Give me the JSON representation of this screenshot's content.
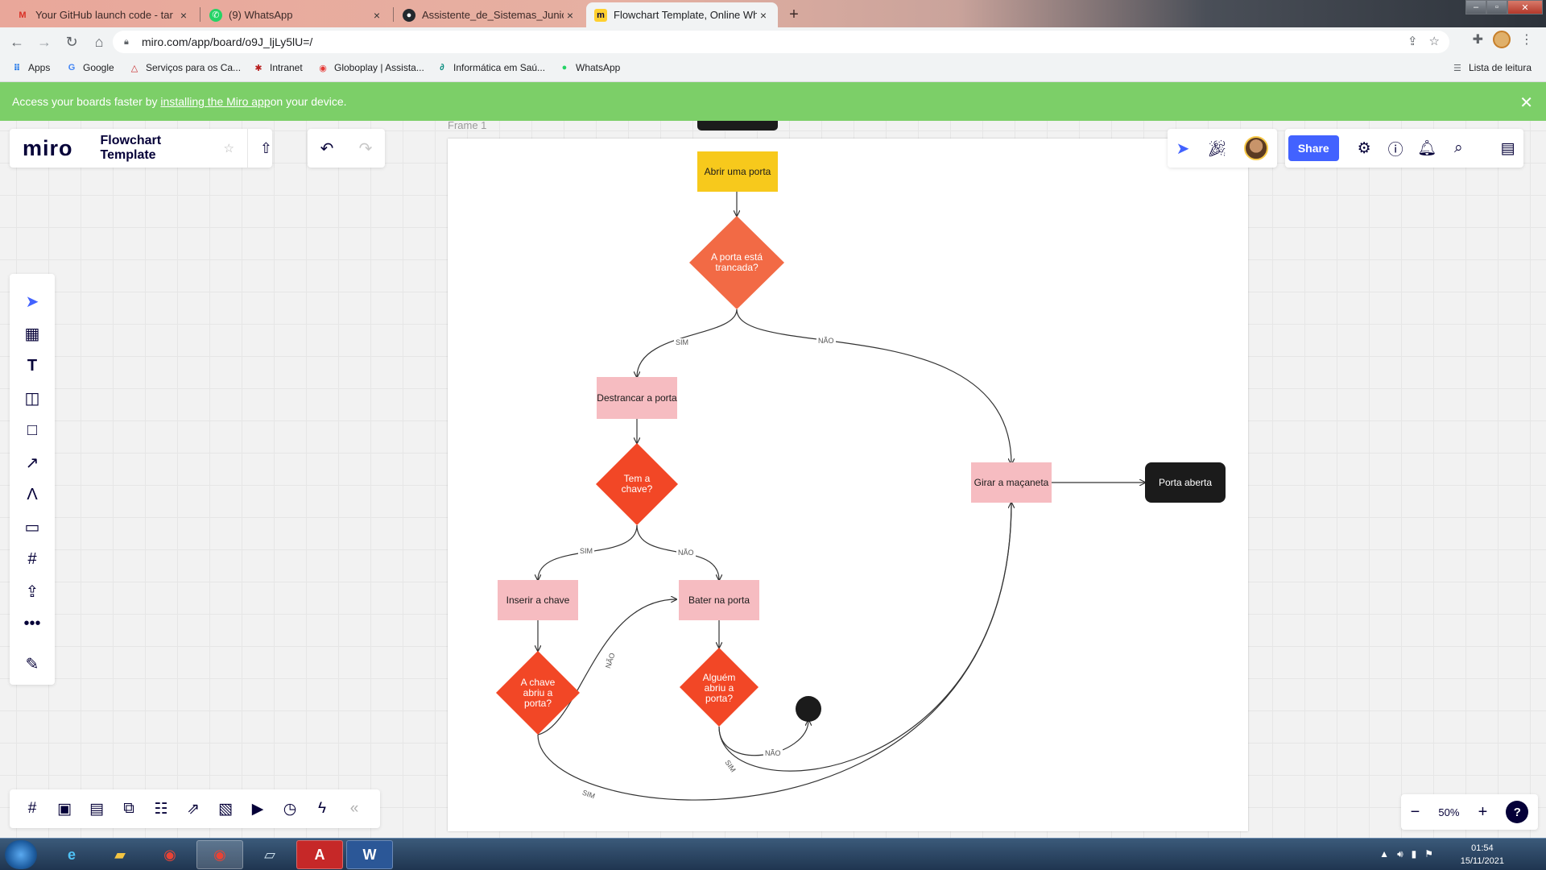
{
  "browser": {
    "tabs": [
      {
        "title": "Your GitHub launch code - tar",
        "icon": "gmail-icon"
      },
      {
        "title": "(9) WhatsApp",
        "icon": "whatsapp-icon"
      },
      {
        "title": "Assistente_de_Sistemas_Junior-T",
        "icon": "github-icon"
      },
      {
        "title": "Flowchart Template, Online Whit",
        "icon": "miro-icon",
        "active": true
      }
    ],
    "url": "miro.com/app/board/o9J_ljLy5lU=/",
    "bookmarks": [
      {
        "label": "Apps",
        "icon": "apps-grid-icon"
      },
      {
        "label": "Google",
        "icon": "google-icon"
      },
      {
        "label": "Serviços para os Ca...",
        "icon": "gov-icon"
      },
      {
        "label": "Intranet",
        "icon": "intranet-icon"
      },
      {
        "label": "Globoplay | Assista...",
        "icon": "globoplay-icon"
      },
      {
        "label": "Informática em Saú...",
        "icon": "link-icon"
      },
      {
        "label": "WhatsApp",
        "icon": "whatsapp-icon"
      }
    ],
    "reading_list": "Lista de leitura"
  },
  "banner": {
    "text_before": "Access your boards faster by ",
    "link": "installing the Miro app",
    "text_after": " on your device."
  },
  "miro": {
    "logo": "miro",
    "board_name": "Flowchart Template",
    "share_label": "Share",
    "frame_label": "Frame 1",
    "zoom": "50%",
    "help": "?"
  },
  "flowchart": {
    "nodes": {
      "start": "Abrir uma porta",
      "locked": "A porta está trancada?",
      "unlock": "Destrancar a porta",
      "has_key": "Tem a chave?",
      "insert_key": "Inserir a chave",
      "knock": "Bater na porta",
      "key_opened": "A chave abriu a porta?",
      "someone_opened": "Alguém abriu a porta?",
      "turn_handle": "Girar a maçaneta",
      "door_open": "Porta aberta"
    },
    "edge_labels": {
      "locked_yes": "SIM",
      "locked_no": "NÃO",
      "key_yes": "SIM",
      "key_no": "NÃO",
      "keyopen_no": "NÃO",
      "keyopen_yes": "SIM",
      "someone_no": "NÃO",
      "someone_yes": "SIM"
    }
  },
  "taskbar": {
    "time": "01:54",
    "date": "15/11/2021"
  },
  "colors": {
    "banner": "#7ccf68",
    "accent": "#4262ff",
    "yellow_node": "#f7c91c",
    "diamond": "#f24726",
    "pink_node": "#f6bcc1",
    "black_node": "#1b1b1b"
  }
}
